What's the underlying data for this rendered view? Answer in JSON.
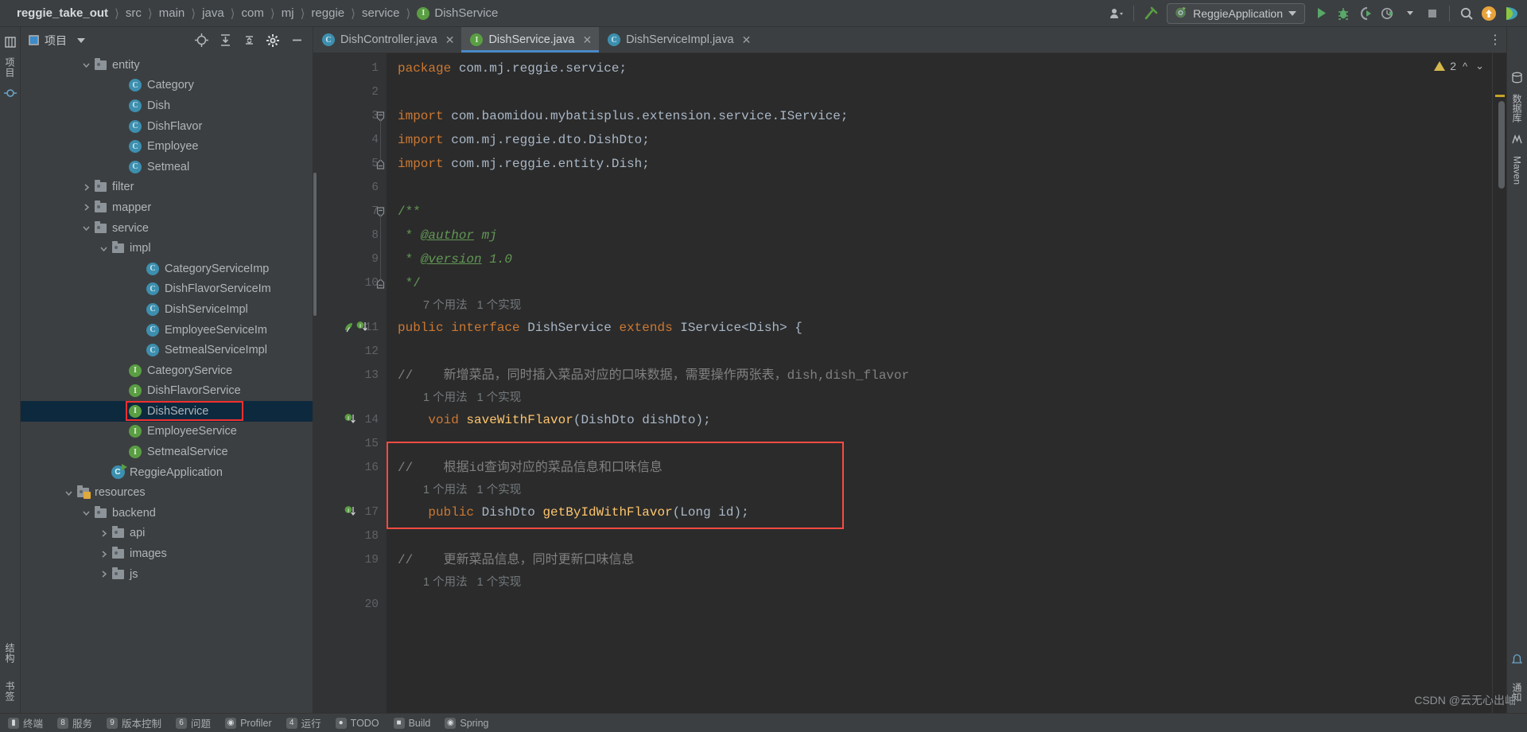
{
  "breadcrumbs": [
    {
      "label": "reggie_take_out",
      "icon": null
    },
    {
      "label": "src",
      "icon": null
    },
    {
      "label": "main",
      "icon": null
    },
    {
      "label": "java",
      "icon": null
    },
    {
      "label": "com",
      "icon": null
    },
    {
      "label": "mj",
      "icon": null
    },
    {
      "label": "reggie",
      "icon": null
    },
    {
      "label": "service",
      "icon": null
    },
    {
      "label": "DishService",
      "icon": "interface-icon"
    }
  ],
  "toolbar": {
    "run_config": "ReggieApplication",
    "icons": [
      "user-dropdown-icon",
      "build-hammer-icon",
      "run-icon",
      "debug-icon",
      "run-coverage-icon",
      "profiler-icon",
      "stop-icon",
      "search-icon",
      "update-icon",
      "ide-feature-icon"
    ]
  },
  "project_panel": {
    "title": "项目",
    "header_icons": [
      "locate-icon",
      "expand-all-icon",
      "collapse-all-icon",
      "settings-icon",
      "hide-icon"
    ],
    "tree": [
      {
        "depth": 3,
        "arrow": "down",
        "icon": "folder",
        "label": "entity",
        "selected": false
      },
      {
        "depth": 5,
        "arrow": "none",
        "icon": "class",
        "label": "Category",
        "selected": false
      },
      {
        "depth": 5,
        "arrow": "none",
        "icon": "class",
        "label": "Dish",
        "selected": false
      },
      {
        "depth": 5,
        "arrow": "none",
        "icon": "class",
        "label": "DishFlavor",
        "selected": false
      },
      {
        "depth": 5,
        "arrow": "none",
        "icon": "class",
        "label": "Employee",
        "selected": false
      },
      {
        "depth": 5,
        "arrow": "none",
        "icon": "class",
        "label": "Setmeal",
        "selected": false
      },
      {
        "depth": 3,
        "arrow": "right",
        "icon": "folder",
        "label": "filter",
        "selected": false
      },
      {
        "depth": 3,
        "arrow": "right",
        "icon": "folder",
        "label": "mapper",
        "selected": false
      },
      {
        "depth": 3,
        "arrow": "down",
        "icon": "folder",
        "label": "service",
        "selected": false
      },
      {
        "depth": 4,
        "arrow": "down",
        "icon": "folder",
        "label": "impl",
        "selected": false
      },
      {
        "depth": 6,
        "arrow": "none",
        "icon": "class",
        "label": "CategoryServiceImp",
        "selected": false
      },
      {
        "depth": 6,
        "arrow": "none",
        "icon": "class",
        "label": "DishFlavorServiceIm",
        "selected": false
      },
      {
        "depth": 6,
        "arrow": "none",
        "icon": "class",
        "label": "DishServiceImpl",
        "selected": false
      },
      {
        "depth": 6,
        "arrow": "none",
        "icon": "class",
        "label": "EmployeeServiceIm",
        "selected": false
      },
      {
        "depth": 6,
        "arrow": "none",
        "icon": "class",
        "label": "SetmealServiceImpl",
        "selected": false
      },
      {
        "depth": 5,
        "arrow": "none",
        "icon": "interface",
        "label": "CategoryService",
        "selected": false
      },
      {
        "depth": 5,
        "arrow": "none",
        "icon": "interface",
        "label": "DishFlavorService",
        "selected": false
      },
      {
        "depth": 5,
        "arrow": "none",
        "icon": "interface",
        "label": "DishService",
        "selected": true
      },
      {
        "depth": 5,
        "arrow": "none",
        "icon": "interface",
        "label": "EmployeeService",
        "selected": false
      },
      {
        "depth": 5,
        "arrow": "none",
        "icon": "interface",
        "label": "SetmealService",
        "selected": false
      },
      {
        "depth": 4,
        "arrow": "none",
        "icon": "spring",
        "label": "ReggieApplication",
        "selected": false
      },
      {
        "depth": 2,
        "arrow": "down",
        "icon": "resources",
        "label": "resources",
        "selected": false
      },
      {
        "depth": 3,
        "arrow": "down",
        "icon": "folder",
        "label": "backend",
        "selected": false
      },
      {
        "depth": 4,
        "arrow": "right",
        "icon": "folder",
        "label": "api",
        "selected": false
      },
      {
        "depth": 4,
        "arrow": "right",
        "icon": "folder",
        "label": "images",
        "selected": false
      },
      {
        "depth": 4,
        "arrow": "right",
        "icon": "folder",
        "label": "js",
        "selected": false
      }
    ]
  },
  "editor": {
    "tabs": [
      {
        "label": "DishController.java",
        "icon": "class-icon",
        "active": false
      },
      {
        "label": "DishService.java",
        "icon": "interface-icon",
        "active": true
      },
      {
        "label": "DishServiceImpl.java",
        "icon": "class-icon",
        "active": false
      }
    ],
    "inspection": {
      "warning_count": "2"
    },
    "lines": [
      {
        "num": "1",
        "segments": [
          {
            "t": "package",
            "c": "kw"
          },
          {
            "t": " com.mj.reggie.service;",
            "c": "plain"
          }
        ]
      },
      {
        "num": "2",
        "segments": []
      },
      {
        "num": "3",
        "fold": "down",
        "segments": [
          {
            "t": "import",
            "c": "kw"
          },
          {
            "t": " com.baomidou.mybatisplus.extension.service.IService;",
            "c": "plain"
          }
        ]
      },
      {
        "num": "4",
        "segments": [
          {
            "t": "import",
            "c": "kw"
          },
          {
            "t": " com.mj.reggie.dto.DishDto;",
            "c": "plain"
          }
        ]
      },
      {
        "num": "5",
        "fold": "up",
        "segments": [
          {
            "t": "import",
            "c": "kw"
          },
          {
            "t": " com.mj.reggie.entity.Dish;",
            "c": "plain"
          }
        ]
      },
      {
        "num": "6",
        "segments": []
      },
      {
        "num": "7",
        "fold": "down",
        "segments": [
          {
            "t": "/**",
            "c": "jdoc"
          }
        ]
      },
      {
        "num": "8",
        "segments": [
          {
            "t": " * ",
            "c": "jdoc"
          },
          {
            "t": "@author",
            "c": "jtag"
          },
          {
            "t": " mj",
            "c": "jtxt"
          }
        ]
      },
      {
        "num": "9",
        "segments": [
          {
            "t": " * ",
            "c": "jdoc"
          },
          {
            "t": "@version",
            "c": "jtag"
          },
          {
            "t": " 1.0",
            "c": "jtxt"
          }
        ]
      },
      {
        "num": "10",
        "fold": "up",
        "segments": [
          {
            "t": " */",
            "c": "jdoc"
          }
        ]
      },
      {
        "num": "11",
        "gutter_icons": [
          "implemented-icon",
          "usage-icon"
        ],
        "hint": "7 个用法   1 个实现",
        "segments": [
          {
            "t": "public interface ",
            "c": "kw"
          },
          {
            "t": "DishService",
            "c": "type"
          },
          {
            "t": " extends ",
            "c": "kw"
          },
          {
            "t": "IService<Dish> {",
            "c": "plain"
          }
        ]
      },
      {
        "num": "12",
        "segments": []
      },
      {
        "num": "13",
        "segments": [
          {
            "t": "//    新增菜品，同时插入菜品对应的口味数据，需要操作两张表，dish,dish_flavor",
            "c": "cmt"
          }
        ]
      },
      {
        "num": "14",
        "gutter_icons": [
          "usage-icon"
        ],
        "hint": "1 个用法   1 个实现",
        "segments": [
          {
            "t": "    void ",
            "c": "kw"
          },
          {
            "t": "saveWithFlavor",
            "c": "mth"
          },
          {
            "t": "(",
            "c": "plain"
          },
          {
            "t": "DishDto",
            "c": "type"
          },
          {
            "t": " dishDto);",
            "c": "plain"
          }
        ]
      },
      {
        "num": "15",
        "segments": []
      },
      {
        "num": "16",
        "segments": [
          {
            "t": "//    根据id查询对应的菜品信息和口味信息",
            "c": "cmt"
          }
        ]
      },
      {
        "num": "17",
        "gutter_icons": [
          "usage-icon"
        ],
        "hint": "1 个用法   1 个实现",
        "segments": [
          {
            "t": "    public ",
            "c": "kw"
          },
          {
            "t": "DishDto ",
            "c": "type"
          },
          {
            "t": "getByIdWithFlavor",
            "c": "mth"
          },
          {
            "t": "(",
            "c": "plain"
          },
          {
            "t": "Long",
            "c": "type"
          },
          {
            "t": " id);",
            "c": "plain"
          }
        ]
      },
      {
        "num": "18",
        "segments": []
      },
      {
        "num": "19",
        "segments": [
          {
            "t": "//    更新菜品信息，同时更新口味信息",
            "c": "cmt"
          }
        ]
      },
      {
        "num": "20",
        "hint": "1 个用法   1 个实现",
        "segments": []
      }
    ]
  },
  "left_rail": {
    "tabs": [
      "项目",
      "提交"
    ],
    "bottom_tabs": [
      "结构",
      "书签"
    ]
  },
  "right_rail": {
    "tabs": [
      "数据库",
      "Maven",
      "通知"
    ]
  },
  "status_bar": {
    "items": [
      "终端",
      "服务",
      "版本控制",
      "问题",
      "Profiler",
      "运行",
      "TODO",
      "Build",
      "Spring"
    ]
  },
  "watermark": "CSDN @云无心出岫",
  "colors": {
    "accent": "#4a88c7",
    "selection": "#0d293e",
    "highlight_box": "#fb4b42",
    "keyword": "#cc7832",
    "method": "#ffc66d",
    "comment": "#808080",
    "javadoc": "#629755",
    "editor_bg": "#2b2b2b",
    "panel_bg": "#3c3f41"
  }
}
